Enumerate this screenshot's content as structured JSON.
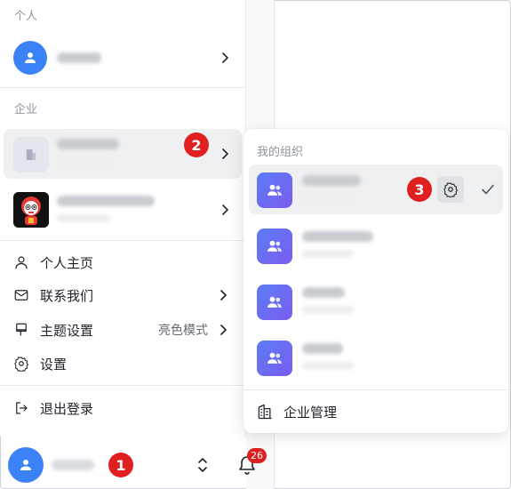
{
  "left_panel": {
    "personal_section_label": "个人",
    "enterprise_section_label": "企业",
    "menu": [
      {
        "label": "个人主页",
        "icon": "user-icon"
      },
      {
        "label": "联系我们",
        "icon": "mail-icon"
      },
      {
        "label": "主题设置",
        "icon": "brush-icon",
        "value": "亮色模式"
      },
      {
        "label": "设置",
        "icon": "gear-icon"
      }
    ],
    "logout_label": "退出登录"
  },
  "annotations": {
    "step1": "1",
    "step2": "2",
    "step3": "3"
  },
  "bottom_bar": {
    "notification_count": "26"
  },
  "org_popover": {
    "title": "我的组织",
    "manage_label": "企业管理"
  },
  "colors": {
    "accent_blue": "#3b82f6",
    "org_gradient_start": "#5b7cf5",
    "org_gradient_end": "#7a5cf0",
    "badge_red": "#e02020"
  }
}
